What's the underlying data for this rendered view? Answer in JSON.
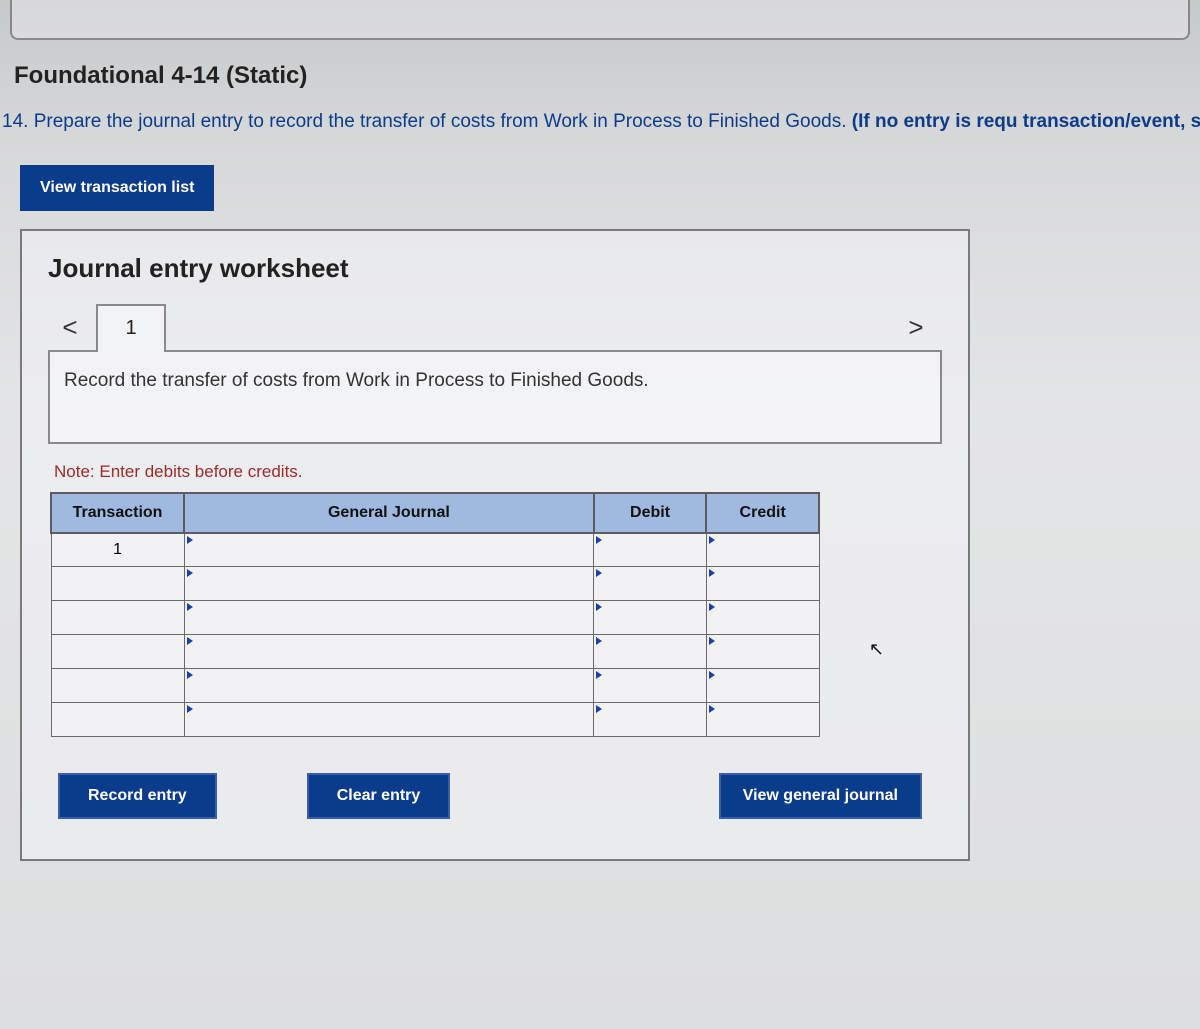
{
  "title": "Foundational 4-14 (Static)",
  "instruction_plain": "14. Prepare the journal entry to record the transfer of costs from Work in Process to Finished Goods. ",
  "instruction_bold": "(If no entry is requ transaction/event, select \"No journal entry required\" in the first account field.)",
  "btn_view_list": "View transaction list",
  "worksheet": {
    "heading": "Journal entry worksheet",
    "prev": "<",
    "tab": "1",
    "next": ">",
    "description": "Record the transfer of costs from Work in Process to Finished Goods.",
    "note": "Note: Enter debits before credits.",
    "headers": {
      "transaction": "Transaction",
      "general_journal": "General Journal",
      "debit": "Debit",
      "credit": "Credit"
    },
    "rows": [
      {
        "transaction": "1",
        "gj": "",
        "debit": "",
        "credit": ""
      },
      {
        "transaction": "",
        "gj": "",
        "debit": "",
        "credit": ""
      },
      {
        "transaction": "",
        "gj": "",
        "debit": "",
        "credit": ""
      },
      {
        "transaction": "",
        "gj": "",
        "debit": "",
        "credit": ""
      },
      {
        "transaction": "",
        "gj": "",
        "debit": "",
        "credit": ""
      },
      {
        "transaction": "",
        "gj": "",
        "debit": "",
        "credit": ""
      }
    ],
    "btn_record": "Record entry",
    "btn_clear": "Clear entry",
    "btn_view_journal": "View general journal"
  }
}
